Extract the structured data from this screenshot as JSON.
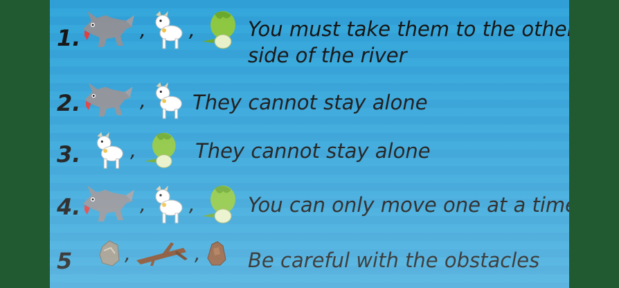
{
  "rules": [
    {
      "number": "1.",
      "icons": [
        "wolf-icon",
        "goat-icon",
        "cabbage-icon"
      ],
      "text_line1": "You must take them to the other",
      "text_line2": "side of the river"
    },
    {
      "number": "2.",
      "icons": [
        "wolf-icon",
        "goat-icon"
      ],
      "text_line1": "They cannot stay alone"
    },
    {
      "number": "3.",
      "icons": [
        "goat-icon",
        "cabbage-icon"
      ],
      "text_line1": "They cannot stay alone"
    },
    {
      "number": "4.",
      "icons": [
        "wolf-icon",
        "goat-icon",
        "cabbage-icon"
      ],
      "text_line1": "You can only move one at a time"
    },
    {
      "number": "5",
      "icons": [
        "rock-icon",
        "log-icon",
        "stump-icon"
      ],
      "text_line1": "Be careful with the obstacles"
    }
  ],
  "separator": ",",
  "colors": {
    "panel_blue": "#2f9fd6",
    "side_green": "#215a30",
    "text": "#111111"
  }
}
